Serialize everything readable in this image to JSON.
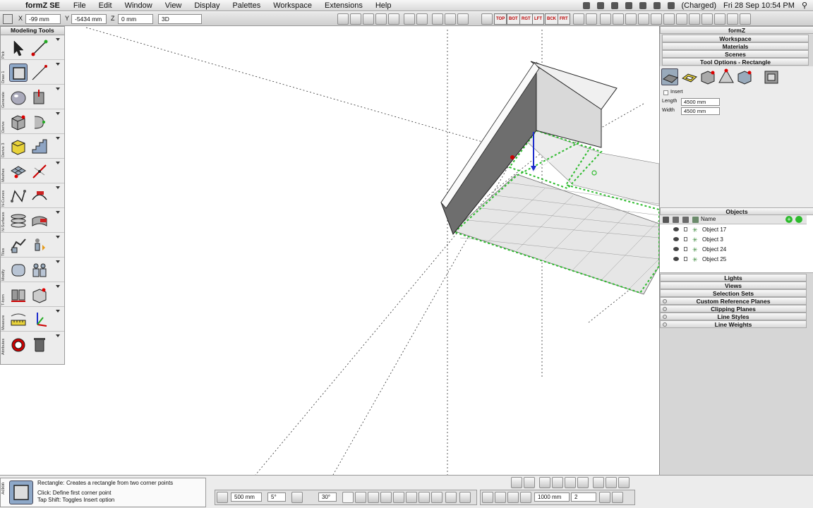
{
  "menubar": {
    "app_name": "formZ SE",
    "items": [
      "File",
      "Edit",
      "Window",
      "View",
      "Display",
      "Palettes",
      "Workspace",
      "Extensions",
      "Help"
    ],
    "status_battery": "(Charged)",
    "status_clock": "Fri 28 Sep  10:54 PM"
  },
  "coords": {
    "x_label": "X",
    "x_value": "-99 mm",
    "y_label": "Y",
    "y_value": "-5434 mm",
    "z_label": "Z",
    "z_value": "0 mm",
    "mode_value": "3D"
  },
  "view_buttons": [
    "TOP",
    "BOT",
    "RGT",
    "LFT",
    "BCK",
    "FRT"
  ],
  "modeling": {
    "title": "Modeling Tools",
    "rows": [
      {
        "label": "Pick"
      },
      {
        "label": "Draw 1"
      },
      {
        "label": "Generate"
      },
      {
        "label": "Derive"
      },
      {
        "label": "Derive 3"
      },
      {
        "label": "Meshes"
      },
      {
        "label": "N-Curves"
      },
      {
        "label": "N-Surfaces"
      },
      {
        "label": "Tiles"
      },
      {
        "label": "Modify"
      },
      {
        "label": "T-form"
      },
      {
        "label": "Measure"
      },
      {
        "label": "Attributes"
      }
    ]
  },
  "panel": {
    "title": "formZ",
    "sections_top": [
      "Workspace",
      "Materials",
      "Scenes",
      "Tool Options - Rectangle"
    ],
    "insert_label": "Insert",
    "length_label": "Length",
    "length_value": "4500 mm",
    "width_label": "Width",
    "width_value": "4500 mm",
    "objects_title": "Objects",
    "objects_header": "Name",
    "objects": [
      "Object 17",
      "Object 3",
      "Object 24",
      "Object 25"
    ],
    "sections_bottom": [
      "Lights",
      "Views",
      "Selection Sets",
      "Custom Reference Planes",
      "Clipping Planes",
      "Line Styles",
      "Line Weights"
    ]
  },
  "hint": {
    "side_label": "Action",
    "tool_name": "Rectangle:",
    "description": "Creates a rectangle from two corner points",
    "click_text": "Click: Define first corner point",
    "tap_text": "Tap Shift: Toggles Insert option"
  },
  "bottom": {
    "grid_value": "500 mm",
    "angle_a": "5°",
    "angle_b": "30°",
    "distance_value": "1000 mm",
    "count_value": "2"
  },
  "colors": {
    "accent_green": "#2dbb2d",
    "axis_blue": "#1c2ccc",
    "menubar_bg": "#e4e4e4"
  }
}
